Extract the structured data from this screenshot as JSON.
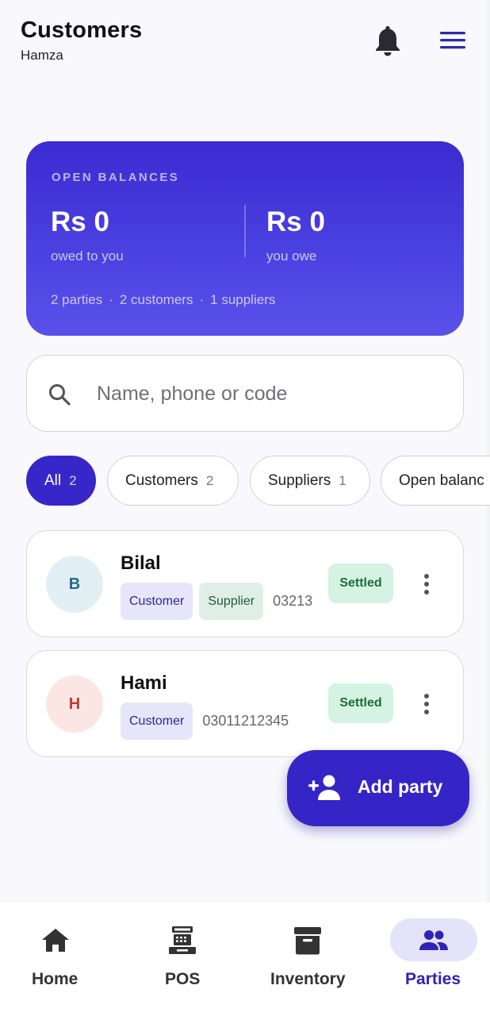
{
  "header": {
    "title": "Customers",
    "subtitle": "Hamza"
  },
  "balance": {
    "label": "OPEN BALANCES",
    "owed_amount": "Rs 0",
    "owed_label": "owed to you",
    "owe_amount": "Rs 0",
    "owe_label": "you owe",
    "parties": "2 parties",
    "customers": "2 customers",
    "suppliers": "1 suppliers",
    "separator": "·"
  },
  "search": {
    "placeholder": "Name, phone or code",
    "value": ""
  },
  "filters": [
    {
      "label": "All",
      "count": "2"
    },
    {
      "label": "Customers",
      "count": "2"
    },
    {
      "label": "Suppliers",
      "count": "1"
    },
    {
      "label": "Open balanc",
      "count": ""
    }
  ],
  "parties": [
    {
      "initial": "B",
      "name": "Bilal",
      "tags": [
        "Customer",
        "Supplier"
      ],
      "phone": "03213",
      "status": "Settled"
    },
    {
      "initial": "H",
      "name": "Hami",
      "tags": [
        "Customer"
      ],
      "phone": "03011212345",
      "status": "Settled"
    }
  ],
  "fab": {
    "label": "Add party",
    "icon": "person-add-icon"
  },
  "nav": [
    {
      "label": "Home",
      "icon": "home-icon"
    },
    {
      "label": "POS",
      "icon": "cash-register-icon"
    },
    {
      "label": "Inventory",
      "icon": "archive-box-icon"
    },
    {
      "label": "Parties",
      "icon": "people-icon"
    }
  ],
  "colors": {
    "accent": "#3727c9",
    "card_top": "#3a2bd1",
    "card_bottom": "#5a51ea",
    "settled_bg": "#d4f3e2",
    "settled_text": "#1f6b40"
  }
}
